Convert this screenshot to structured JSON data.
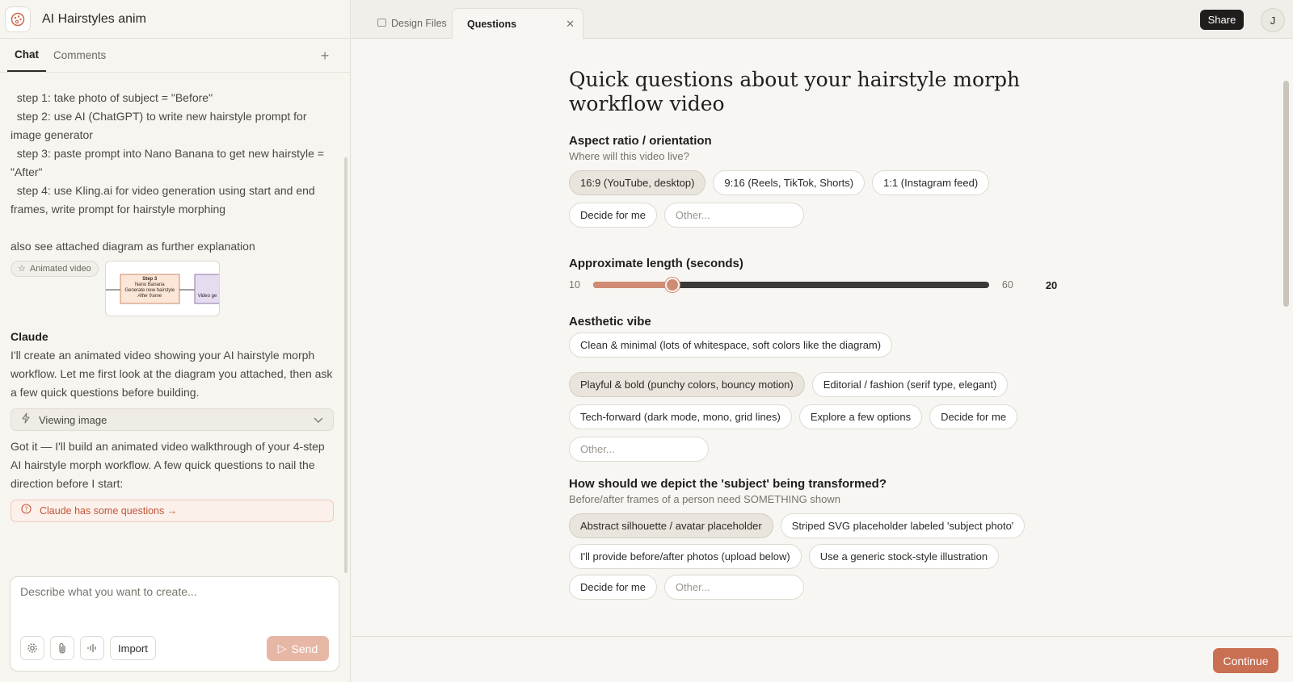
{
  "app": {
    "project_title": "AI Hairstyles anim"
  },
  "left_tabs": {
    "chat": "Chat",
    "comments": "Comments"
  },
  "chat": {
    "user_lines": [
      "  step 1: take photo of subject = \"Before\"",
      "  step 2: use AI (ChatGPT) to write new hairstyle prompt for image generator",
      "  step 3: paste prompt into Nano Banana to get new hairstyle = \"After\"",
      "  step 4: use Kling.ai for video generation using start and end frames, write prompt for hairstyle morphing",
      "also see attached diagram as further explanation"
    ],
    "attachment_chip": "Animated video",
    "diagram": {
      "box1_lines": [
        "Step 3",
        "Nano Banana",
        "Generate new hairstyle",
        "After frame"
      ],
      "box2_label": "Video ge"
    },
    "assistant_name": "Claude",
    "assistant_msg1": "I'll create an animated video showing your AI hairstyle morph workflow. Let me first look at the diagram you attached, then ask a few quick questions before building.",
    "viewing_label": "Viewing image",
    "assistant_msg2": "Got it — I'll build an animated video walkthrough of your 4-step AI hairstyle morph workflow. A few quick questions to nail the direction before I start:",
    "questions_link": "Claude has some questions →"
  },
  "composer": {
    "placeholder": "Describe what you want to create...",
    "import_label": "Import",
    "send_label": "Send"
  },
  "tabs": {
    "design_files": "Design Files",
    "questions": "Questions"
  },
  "header": {
    "share_label": "Share",
    "avatar_initial": "J"
  },
  "form": {
    "title": "Quick questions about your hairstyle morph workflow video",
    "q1": {
      "title": "Aspect ratio / orientation",
      "subtitle": "Where will this video live?",
      "options": [
        "16:9 (YouTube, desktop)",
        "9:16 (Reels, TikTok, Shorts)",
        "1:1 (Instagram feed)",
        "Decide for me"
      ],
      "other_placeholder": "Other..."
    },
    "q2": {
      "title": "Approximate length (seconds)",
      "min": "10",
      "max": "60",
      "value": 20,
      "value_label": "20"
    },
    "q3": {
      "title": "Aesthetic vibe",
      "options": [
        "Clean & minimal (lots of whitespace, soft colors like the diagram)",
        "Playful & bold (punchy colors, bouncy motion)",
        "Editorial / fashion (serif type, elegant)",
        "Tech-forward (dark mode, mono, grid lines)",
        "Explore a few options",
        "Decide for me"
      ],
      "other_placeholder": "Other..."
    },
    "q4": {
      "title": "How should we depict the 'subject' being transformed?",
      "subtitle": "Before/after frames of a person need SOMETHING shown",
      "options": [
        "Abstract silhouette / avatar placeholder",
        "Striped SVG placeholder labeled 'subject photo'",
        "I'll provide before/after photos (upload below)",
        "Use a generic stock-style illustration",
        "Decide for me"
      ],
      "other_placeholder": "Other..."
    }
  },
  "footer": {
    "continue_label": "Continue"
  },
  "colors": {
    "accent": "#c96f52",
    "accent_soft": "#d08b74",
    "selected_chip": "#e9e5dc"
  }
}
